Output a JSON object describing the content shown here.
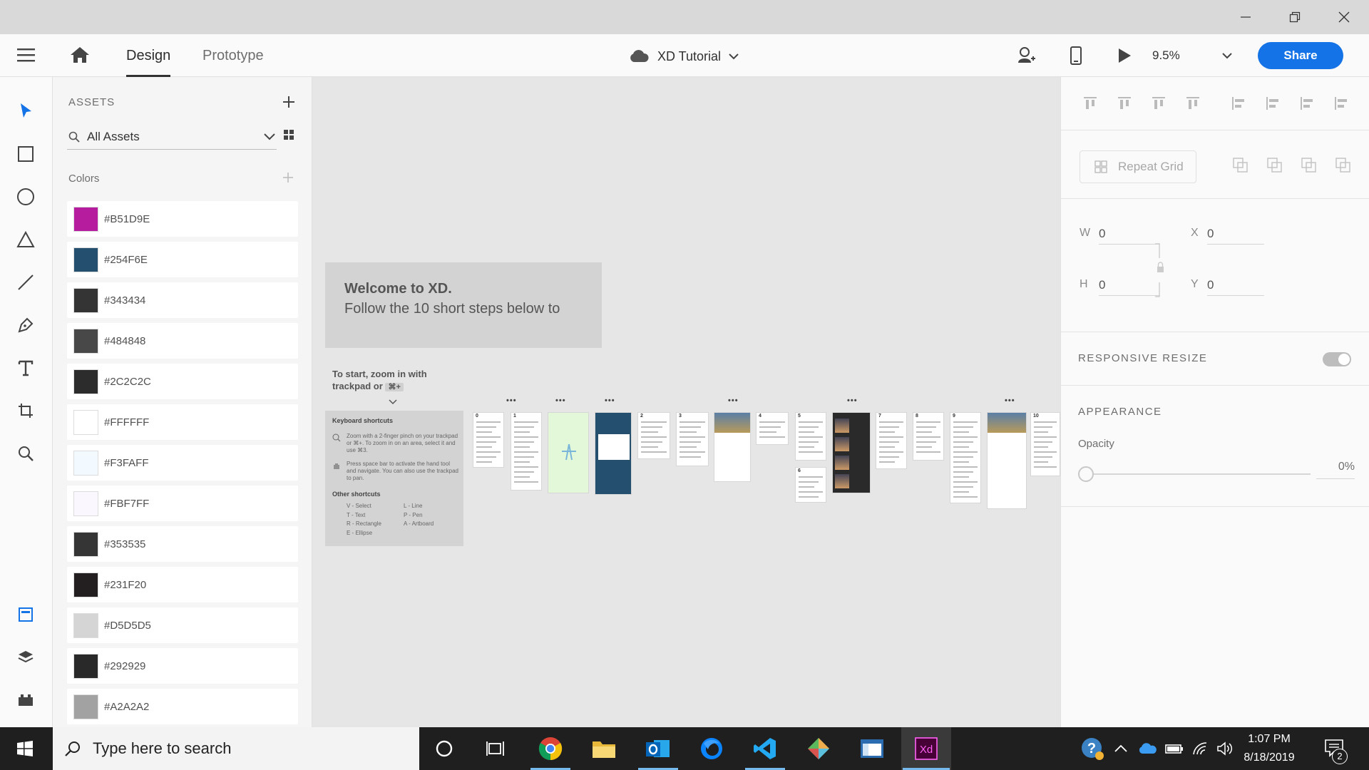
{
  "window": {
    "minimize_icon": "minimize-icon",
    "restore_icon": "restore-icon",
    "close_icon": "close-icon"
  },
  "appbar": {
    "tabs": [
      {
        "label": "Design"
      },
      {
        "label": "Prototype"
      }
    ],
    "document_title": "XD Tutorial",
    "zoom": "9.5%",
    "share_label": "Share",
    "accent": "#1473e6"
  },
  "assets": {
    "header": "ASSETS",
    "filter": "All Assets",
    "colors_title": "Colors",
    "colors": [
      {
        "label": "#B51D9E",
        "hex": "#B51D9E"
      },
      {
        "label": "#254F6E",
        "hex": "#254F6E"
      },
      {
        "label": "#343434",
        "hex": "#343434"
      },
      {
        "label": "#484848",
        "hex": "#484848"
      },
      {
        "label": "#2C2C2C",
        "hex": "#2C2C2C"
      },
      {
        "label": "#FFFFFF",
        "hex": "#FFFFFF"
      },
      {
        "label": "#F3FAFF",
        "hex": "#F3FAFF"
      },
      {
        "label": "#FBF7FF",
        "hex": "#FBF7FF"
      },
      {
        "label": "#353535",
        "hex": "#353535"
      },
      {
        "label": "#231F20",
        "hex": "#231F20"
      },
      {
        "label": "#D5D5D5",
        "hex": "#D5D5D5"
      },
      {
        "label": "#292929",
        "hex": "#292929"
      },
      {
        "label": "#A2A2A2",
        "hex": "#A2A2A2"
      }
    ]
  },
  "canvas": {
    "welcome_title": "Welcome to XD.",
    "welcome_sub": "Follow the 10 short steps below to",
    "zoom_hint_line1": "To start, zoom in with",
    "zoom_hint_line2": "trackpad or",
    "zoom_hint_key": "⌘+",
    "shortcuts_title": "Keyboard shortcuts",
    "shortcut_zoom": "Zoom with a 2-finger pinch on your trackpad or ⌘+. To zoom in on an area, select it and use ⌘3.",
    "shortcut_pan": "Press space bar to activate the hand tool and navigate. You can also use the trackpad to pan.",
    "other_title": "Other shortcuts",
    "other_left": [
      "V - Select",
      "T - Text",
      "R - Rectangle",
      "E - Ellipse"
    ],
    "other_right": [
      "L - Line",
      "P - Pen",
      "A - Artboard"
    ],
    "artboard_numbers": [
      "0",
      "1",
      "2",
      "3",
      "4",
      "5",
      "6",
      "7",
      "8",
      "9",
      "10"
    ]
  },
  "props": {
    "repeat_grid": "Repeat Grid",
    "w_label": "W",
    "w_value": "0",
    "h_label": "H",
    "h_value": "0",
    "x_label": "X",
    "x_value": "0",
    "y_label": "Y",
    "y_value": "0",
    "responsive_resize": "RESPONSIVE RESIZE",
    "appearance": "APPEARANCE",
    "opacity_label": "Opacity",
    "opacity_value": "0%"
  },
  "taskbar": {
    "search_placeholder": "Type here to search",
    "time": "1:07 PM",
    "date": "8/18/2019",
    "notification_count": "2"
  }
}
